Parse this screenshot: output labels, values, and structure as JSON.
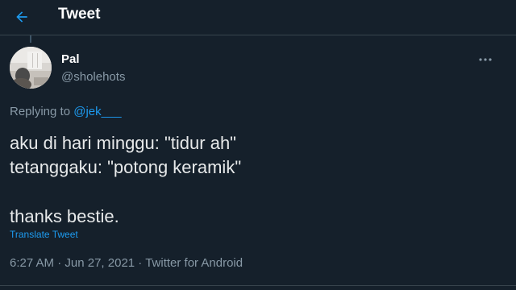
{
  "header": {
    "title": "Tweet",
    "back_icon": "arrow-left-icon",
    "accent_color": "#1d9bf0"
  },
  "tweet": {
    "author_name": "Pal",
    "author_handle": "@sholehots",
    "replying_prefix": "Replying to ",
    "replying_to": "@jek___",
    "lines": [
      "aku di hari minggu: \"tidur ah\"",
      "tetanggaku: \"potong keramik\"",
      "thanks bestie."
    ],
    "translate_label": "Translate Tweet",
    "time": "6:27 AM",
    "separator": " · ",
    "date": "Jun 27, 2021",
    "source": "Twitter for Android",
    "more_icon": "more-horizontal-icon"
  },
  "colors": {
    "background": "#15202b",
    "secondary_text": "#8899a6",
    "link": "#1d9bf0"
  }
}
